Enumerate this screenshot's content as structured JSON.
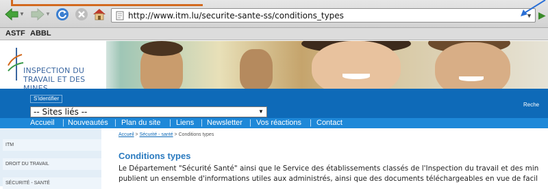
{
  "browser": {
    "url": "http://www.itm.lu/securite-sante-ss/conditions_types",
    "bookmarks": [
      "ASTF",
      "ABBL"
    ]
  },
  "site": {
    "logo_line1": "INSPECTION DU",
    "logo_line2": "TRAVAIL ET DES MINES",
    "identify_label": "S'identifier",
    "search_label": "Reche",
    "sites_select": "-- Sites liés --",
    "menu": [
      "Accueil",
      "Nouveautés",
      "Plan du site",
      "Liens",
      "Newsletter",
      "Vos réactions",
      "Contact"
    ]
  },
  "sidebar": {
    "items": [
      "ITM",
      "DROIT DU TRAVAIL",
      "SÉCURITÉ - SANTÉ"
    ]
  },
  "content": {
    "breadcrumb": {
      "home": "Accueil",
      "sep": " > ",
      "section": "Sécurité - santé",
      "current": "Conditions types"
    },
    "title": "Conditions types",
    "paragraph_line1": "Le Département \"Sécurité Santé\" ainsi que le Service des établissements classés de l'Inspection du travail et des min",
    "paragraph_line2": "publient un ensemble d'informations utiles aux administrés, ainsi que des documents téléchargeables en vue de facil"
  },
  "colors": {
    "brand_blue": "#0e6ab8",
    "menu_blue": "#1e88d8",
    "title_blue": "#2a7abf",
    "annotation": "#d2691e"
  }
}
